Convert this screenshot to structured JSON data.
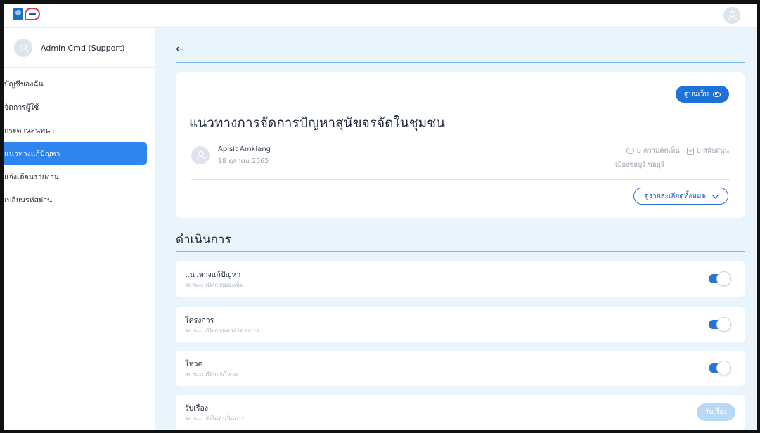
{
  "app": {
    "logo_text": "ทพs"
  },
  "user": {
    "name": "Admin Cmd (Support)"
  },
  "sidebar": {
    "items": [
      {
        "label": "บัญชีของฉัน",
        "active": false
      },
      {
        "label": "จัดการผู้ใช้",
        "active": false
      },
      {
        "label": "กระดานสนทนา",
        "active": false
      },
      {
        "label": "แนวทางแก้ปัญหา",
        "active": true
      },
      {
        "label": "แจ้งเตือนรายงาน",
        "active": false
      },
      {
        "label": "เปลี่ยนรหัสผ่าน",
        "active": false
      }
    ]
  },
  "header": {
    "back_icon": "arrow-left-icon"
  },
  "card": {
    "view_web_label": "ดูบนเว็บ",
    "title": "แนวทางการจัดการปัญหาสุนัขจรจัดในชุมชน",
    "author": "Apisit Amklang",
    "date": "18 ตุลาคม 2565",
    "comments": "0 ความคิดเห็น",
    "supports": "0 สนับสนุน",
    "location": "เมืองชลบุรี ชลบุรี",
    "details_label": "ดูรายละเอียดทั้งหมด"
  },
  "section": {
    "title": "ดำเนินการ"
  },
  "actions": [
    {
      "title": "แนวทางแก้ปัญหา",
      "status": "สถานะ: เปิดการมองเห็น",
      "control": "toggle",
      "on": true
    },
    {
      "title": "โครงการ",
      "status": "สถานะ: เปิดการเสนอโครงการ",
      "control": "toggle",
      "on": true
    },
    {
      "title": "โหวต",
      "status": "สถานะ: เปิดการโหวต",
      "control": "toggle",
      "on": true
    },
    {
      "title": "รับเรื่อง",
      "status": "สถานะ: ยังไม่ดำเนินการ",
      "control": "button",
      "button_label": "รับเรื่อง"
    }
  ],
  "colors": {
    "accent": "#2f85f0",
    "toggle_on": "#2a72d8",
    "page_bg": "#e9f4fb",
    "disabled_button": "#b7d8f6"
  }
}
